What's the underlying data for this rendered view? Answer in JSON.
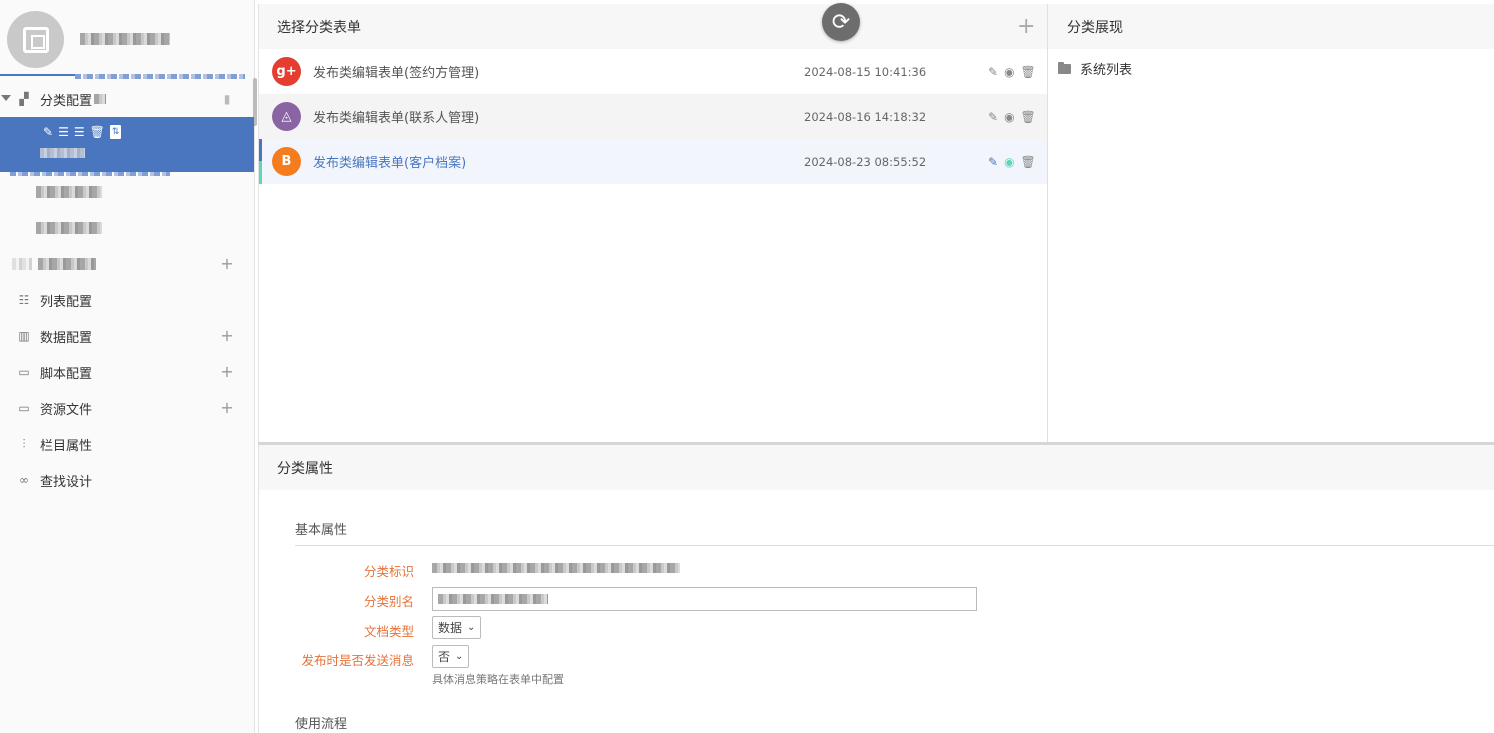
{
  "sidebar": {
    "items": [
      {
        "label": "分类配置",
        "icon": "org-chart-icon"
      },
      {
        "label": "列表配置",
        "icon": "list-icon"
      },
      {
        "label": "数据配置",
        "icon": "bar-chart-icon"
      },
      {
        "label": "脚本配置",
        "icon": "terminal-icon"
      },
      {
        "label": "资源文件",
        "icon": "terminal-icon"
      },
      {
        "label": "栏目属性",
        "icon": "sliders-icon"
      },
      {
        "label": "查找设计",
        "icon": "binoculars-icon"
      }
    ]
  },
  "forms_panel": {
    "title": "选择分类表单",
    "rows": [
      {
        "name": "发布类编辑表单(签约方管理)",
        "date": "2024-08-15 10:41:36",
        "icon_text": "g+"
      },
      {
        "name": "发布类编辑表单(联系人管理)",
        "date": "2024-08-16 14:18:32",
        "icon_text": "◬"
      },
      {
        "name": "发布类编辑表单(客户档案)",
        "date": "2024-08-23 08:55:52",
        "icon_text": "B"
      }
    ]
  },
  "display_panel": {
    "title": "分类展现",
    "items": [
      {
        "label": "系统列表",
        "icon": "folder-icon"
      }
    ]
  },
  "properties": {
    "title": "分类属性",
    "section_basic": "基本属性",
    "section_flow": "使用流程",
    "fields": {
      "id_label": "分类标识",
      "alias_label": "分类别名",
      "doc_type_label": "文档类型",
      "doc_type_value": "数据",
      "notify_label": "发布时是否发送消息",
      "notify_value": "否",
      "notify_hint": "具体消息策略在表单中配置"
    }
  },
  "colors": {
    "accent": "#4a76c0",
    "label_orange": "#e5733a",
    "active_green": "#5dd6b8"
  }
}
